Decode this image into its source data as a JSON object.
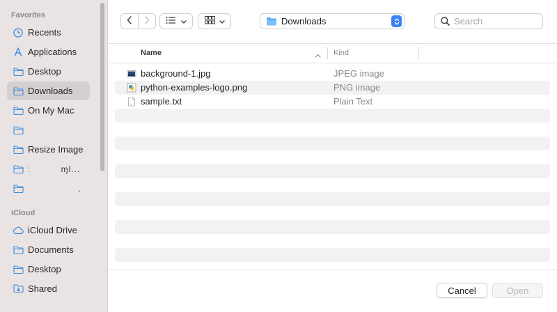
{
  "sidebar": {
    "favorites_title": "Favorites",
    "icloud_title": "iCloud",
    "favorites": [
      {
        "label": "Recents",
        "icon": "clock-icon"
      },
      {
        "label": "Applications",
        "icon": "applications-icon"
      },
      {
        "label": "Desktop",
        "icon": "folder-icon"
      },
      {
        "label": "Downloads",
        "icon": "folder-icon",
        "selected": true
      },
      {
        "label": "On My Mac",
        "icon": "folder-icon"
      },
      {
        "label": "",
        "icon": "folder-icon"
      },
      {
        "label": "Resize Image",
        "icon": "folder-icon"
      },
      {
        "label": "ː          ɱl...",
        "icon": "folder-icon"
      },
      {
        "label": ".",
        "icon": "folder-icon"
      }
    ],
    "icloud": [
      {
        "label": "iCloud Drive",
        "icon": "cloud-icon"
      },
      {
        "label": "Documents",
        "icon": "folder-icon"
      },
      {
        "label": "Desktop",
        "icon": "folder-icon"
      },
      {
        "label": "Shared",
        "icon": "shared-folder-icon"
      }
    ]
  },
  "toolbar": {
    "location": "Downloads",
    "search_placeholder": "Search"
  },
  "columns": {
    "name": "Name",
    "kind": "Kind"
  },
  "files": [
    {
      "name": "background-1.jpg",
      "kind": "JPEG image",
      "icon": "image-file-icon"
    },
    {
      "name": "python-examples-logo.png",
      "kind": "PNG image",
      "icon": "png-file-icon"
    },
    {
      "name": "sample.txt",
      "kind": "Plain Text",
      "icon": "text-file-icon"
    }
  ],
  "footer": {
    "cancel_label": "Cancel",
    "open_label": "Open"
  },
  "colors": {
    "accent": "#3b82f6",
    "sidebar_bg": "#e9e4e3",
    "sidebar_icon": "#3d8ce0"
  }
}
